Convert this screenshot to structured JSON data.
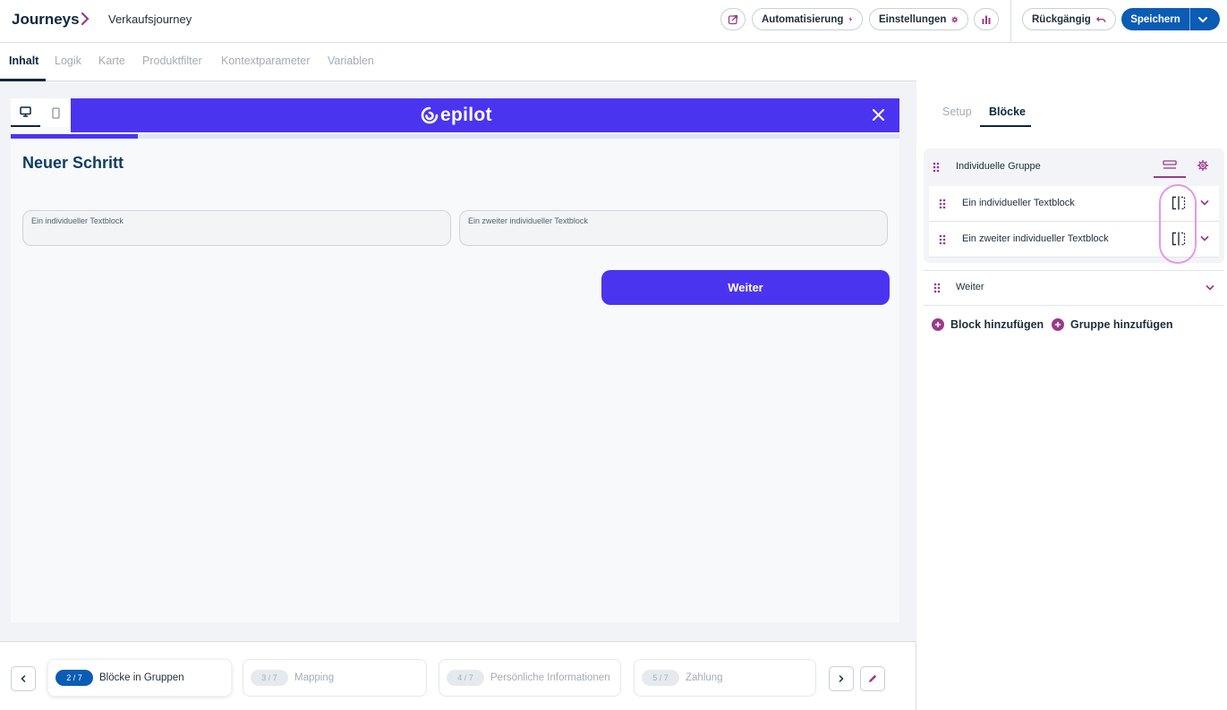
{
  "header": {
    "brand": "Journeys",
    "journey_name": "Verkaufsjourney",
    "automation_label": "Automatisierung",
    "settings_label": "Einstellungen",
    "undo_label": "Rückgängig",
    "save_label": "Speichern"
  },
  "tabs": [
    "Inhalt",
    "Logik",
    "Karte",
    "Produktfilter",
    "Kontextparameter",
    "Variablen"
  ],
  "preview": {
    "logo_text": "epilot",
    "progress_fraction": 0.143,
    "step_title": "Neuer Schritt",
    "field_1_label": "Ein individueller Textblock",
    "field_2_label": "Ein zweiter individueller Textblock",
    "next_button": "Weiter"
  },
  "steps": [
    {
      "num": "2 / 7",
      "label": "Blöcke in Gruppen",
      "active": true
    },
    {
      "num": "3 / 7",
      "label": "Mapping",
      "active": false
    },
    {
      "num": "4 / 7",
      "label": "Persönliche Informationen",
      "active": false
    },
    {
      "num": "5 / 7",
      "label": "Zahlung",
      "active": false
    }
  ],
  "side": {
    "tab_setup": "Setup",
    "tab_blocks": "Blöcke",
    "group_label": "Individuelle Gruppe",
    "block_1": "Ein individueller Textblock",
    "block_2": "Ein zweiter individueller Textblock",
    "weiter_block": "Weiter",
    "add_block": "Block hinzufügen",
    "add_group": "Gruppe hinzufügen"
  },
  "colors": {
    "brand_blue": "#0b5cb4",
    "preview_accent": "#4b34f0",
    "accent_purple": "#9b3a8c",
    "highlight": "#e29ae6"
  },
  "icons": [
    "external-link-icon",
    "lightning-icon",
    "gear-icon",
    "bar-chart-icon",
    "undo-icon",
    "chevron-down-icon",
    "desktop-icon",
    "mobile-icon",
    "close-icon",
    "drag-handle-icon",
    "columns-icon",
    "rows-icon",
    "plus-icon",
    "pencil-icon"
  ]
}
